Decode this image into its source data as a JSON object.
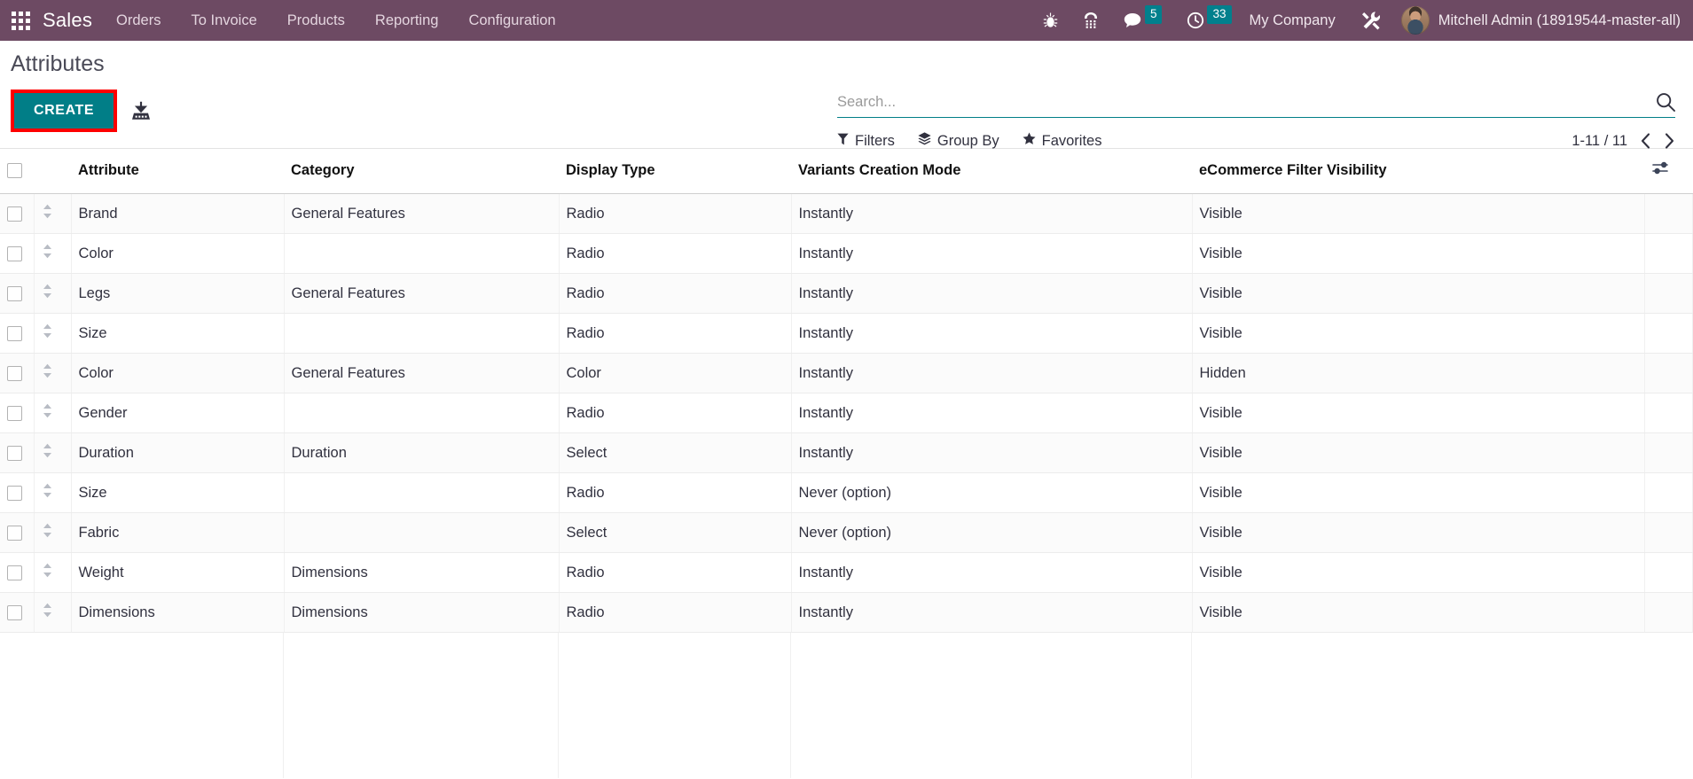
{
  "navbar": {
    "apps_icon": "apps-grid-icon",
    "brand": "Sales",
    "menu": [
      {
        "label": "Orders"
      },
      {
        "label": "To Invoice"
      },
      {
        "label": "Products"
      },
      {
        "label": "Reporting"
      },
      {
        "label": "Configuration"
      }
    ],
    "icons": [
      {
        "name": "bug-icon",
        "badge": null
      },
      {
        "name": "dialpad-icon",
        "badge": null
      },
      {
        "name": "messages-icon",
        "badge": "5"
      },
      {
        "name": "activities-clock-icon",
        "badge": "33"
      }
    ],
    "company": "My Company",
    "tools_icon": "tools-icon",
    "user": "Mitchell Admin (18919544-master-all)",
    "bg_color": "#6d4a63",
    "badge_color": "#01808d"
  },
  "control_panel": {
    "title": "Attributes",
    "create_label": "CREATE",
    "create_color": "#017e87",
    "highlight_color": "#fe0000",
    "import_icon": "import-upload-icon",
    "search": {
      "placeholder": "Search...",
      "value": ""
    },
    "filters": [
      {
        "label": "Filters",
        "icon": "filter-funnel-icon"
      },
      {
        "label": "Group By",
        "icon": "layers-icon"
      },
      {
        "label": "Favorites",
        "icon": "star-icon"
      }
    ],
    "pager": {
      "range": "1-11 / 11",
      "prev_icon": "chevron-left-icon",
      "next_icon": "chevron-right-icon"
    }
  },
  "table": {
    "columns": [
      "Attribute",
      "Category",
      "Display Type",
      "Variants Creation Mode",
      "eCommerce Filter Visibility"
    ],
    "optional_columns_icon": "column-settings-sliders-icon",
    "rows": [
      {
        "attribute": "Brand",
        "category": "General Features",
        "display_type": "Radio",
        "variants_creation_mode": "Instantly",
        "ecommerce_filter_visibility": "Visible"
      },
      {
        "attribute": "Color",
        "category": "",
        "display_type": "Radio",
        "variants_creation_mode": "Instantly",
        "ecommerce_filter_visibility": "Visible"
      },
      {
        "attribute": "Legs",
        "category": "General Features",
        "display_type": "Radio",
        "variants_creation_mode": "Instantly",
        "ecommerce_filter_visibility": "Visible"
      },
      {
        "attribute": "Size",
        "category": "",
        "display_type": "Radio",
        "variants_creation_mode": "Instantly",
        "ecommerce_filter_visibility": "Visible"
      },
      {
        "attribute": "Color",
        "category": "General Features",
        "display_type": "Color",
        "variants_creation_mode": "Instantly",
        "ecommerce_filter_visibility": "Hidden"
      },
      {
        "attribute": "Gender",
        "category": "",
        "display_type": "Radio",
        "variants_creation_mode": "Instantly",
        "ecommerce_filter_visibility": "Visible"
      },
      {
        "attribute": "Duration",
        "category": "Duration",
        "display_type": "Select",
        "variants_creation_mode": "Instantly",
        "ecommerce_filter_visibility": "Visible"
      },
      {
        "attribute": "Size",
        "category": "",
        "display_type": "Radio",
        "variants_creation_mode": "Never (option)",
        "ecommerce_filter_visibility": "Visible"
      },
      {
        "attribute": "Fabric",
        "category": "",
        "display_type": "Select",
        "variants_creation_mode": "Never (option)",
        "ecommerce_filter_visibility": "Visible"
      },
      {
        "attribute": "Weight",
        "category": "Dimensions",
        "display_type": "Radio",
        "variants_creation_mode": "Instantly",
        "ecommerce_filter_visibility": "Visible"
      },
      {
        "attribute": "Dimensions",
        "category": "Dimensions",
        "display_type": "Radio",
        "variants_creation_mode": "Instantly",
        "ecommerce_filter_visibility": "Visible"
      }
    ]
  }
}
